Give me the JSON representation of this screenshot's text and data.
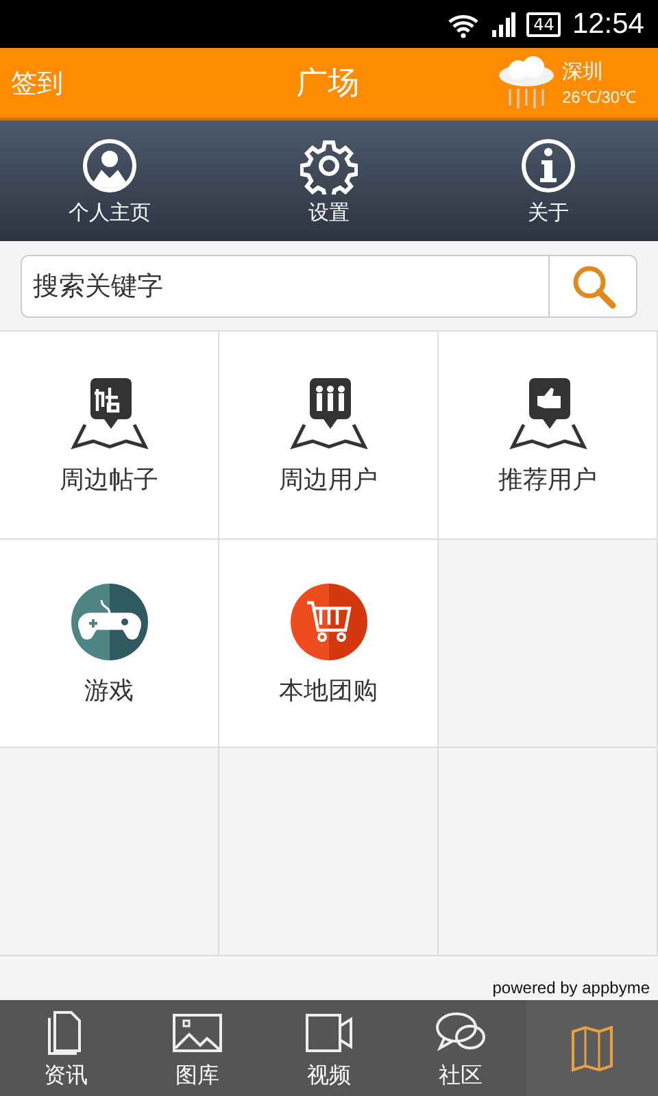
{
  "status_bar": {
    "battery": "44",
    "time": "12:54"
  },
  "header": {
    "left": "签到",
    "title": "广场",
    "weather": {
      "city": "深圳",
      "temp": "26℃/30℃"
    }
  },
  "nav": [
    {
      "kind": "profile",
      "label": "个人主页"
    },
    {
      "kind": "settings",
      "label": "设置"
    },
    {
      "kind": "info",
      "label": "关于"
    }
  ],
  "search": {
    "placeholder": "搜索关键字"
  },
  "grid": [
    {
      "kind": "map-post",
      "label": "周边帖子"
    },
    {
      "kind": "map-people",
      "label": "周边用户"
    },
    {
      "kind": "map-thumb",
      "label": "推荐用户"
    },
    {
      "kind": "game",
      "label": "游戏"
    },
    {
      "kind": "cart",
      "label": "本地团购"
    }
  ],
  "footer": "powered by appbyme",
  "tabs": [
    {
      "kind": "news",
      "label": "资讯",
      "selected": false
    },
    {
      "kind": "gallery",
      "label": "图库",
      "selected": false
    },
    {
      "kind": "video",
      "label": "视频",
      "selected": false
    },
    {
      "kind": "community",
      "label": "社区",
      "selected": false
    },
    {
      "kind": "map",
      "selected": true
    }
  ]
}
